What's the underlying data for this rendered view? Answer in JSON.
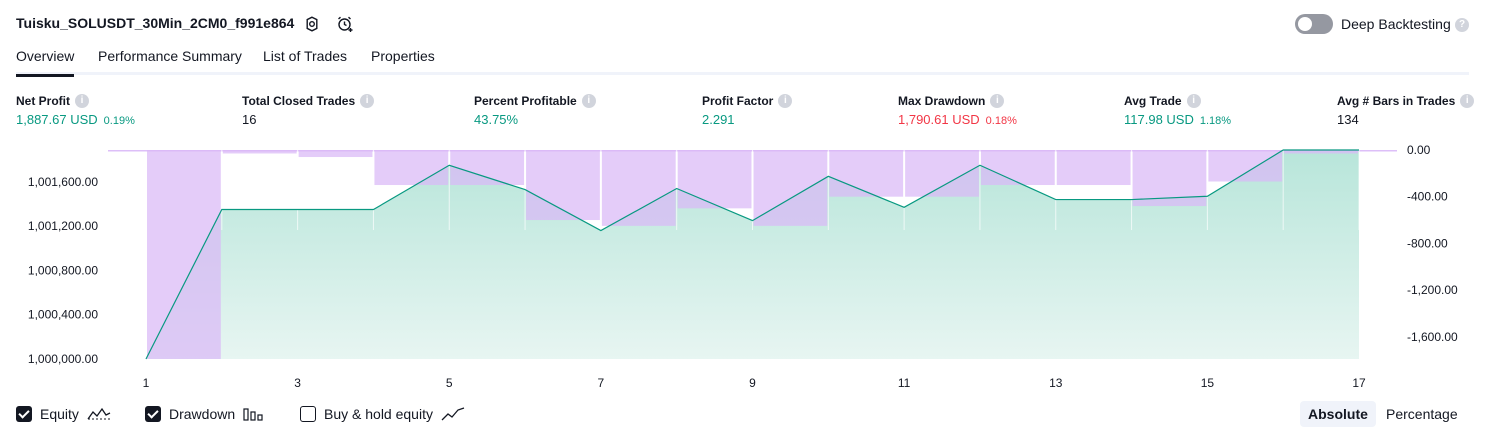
{
  "header": {
    "strategy_title": "Tuisku_SOLUSDT_30Min_2CM0_f991e864",
    "deep_backtesting_label": "Deep Backtesting",
    "deep_backtesting_enabled": false,
    "help_glyph": "?"
  },
  "tabs": [
    {
      "label": "Overview",
      "active": true
    },
    {
      "label": "Performance Summary",
      "active": false
    },
    {
      "label": "List of Trades",
      "active": false
    },
    {
      "label": "Properties",
      "active": false
    }
  ],
  "stats": [
    {
      "label": "Net Profit",
      "value": "1,887.67 USD",
      "percent": "0.19%",
      "tone": "green"
    },
    {
      "label": "Total Closed Trades",
      "value": "16",
      "percent": "",
      "tone": "dark"
    },
    {
      "label": "Percent Profitable",
      "value": "43.75%",
      "percent": "",
      "tone": "green"
    },
    {
      "label": "Profit Factor",
      "value": "2.291",
      "percent": "",
      "tone": "green"
    },
    {
      "label": "Max Drawdown",
      "value": "1,790.61 USD",
      "percent": "0.18%",
      "tone": "red"
    },
    {
      "label": "Avg Trade",
      "value": "117.98 USD",
      "percent": "1.18%",
      "tone": "green"
    },
    {
      "label": "Avg # Bars in Trades",
      "value": "134",
      "percent": "",
      "tone": "dark"
    }
  ],
  "chart_data": {
    "type": "area",
    "x": [
      1,
      2,
      3,
      4,
      5,
      6,
      7,
      8,
      9,
      10,
      11,
      12,
      13,
      14,
      15,
      16,
      17
    ],
    "x_ticks": [
      "1",
      "3",
      "5",
      "7",
      "9",
      "11",
      "13",
      "15",
      "17"
    ],
    "left_axis": {
      "ticks": [
        "1,000,000.00",
        "1,000,400.00",
        "1,000,800.00",
        "1,001,200.00",
        "1,001,600.00"
      ],
      "range": [
        1000000,
        1001887.67
      ]
    },
    "right_axis": {
      "ticks": [
        "0.00",
        "-400.00",
        "-800.00",
        "-1,200.00",
        "-1,600.00"
      ],
      "range": [
        -1790.61,
        0
      ]
    },
    "series": [
      {
        "name": "Equity",
        "color": "#089981",
        "values": [
          1000000,
          1001350,
          1001350,
          1001350,
          1001750,
          1001530,
          1001160,
          1001540,
          1001250,
          1001650,
          1001370,
          1001750,
          1001440,
          1001440,
          1001470,
          1001887.67,
          1001887.67
        ]
      },
      {
        "name": "Drawdown",
        "color": "#c9a8f5",
        "values": [
          0,
          -1790.61,
          -30,
          -60,
          -300,
          -300,
          -600,
          -650,
          -500,
          -650,
          -400,
          -400,
          -300,
          -300,
          -480,
          -270,
          -30
        ]
      }
    ],
    "grid": false
  },
  "legend": [
    {
      "label": "Equity",
      "checked": true,
      "icon": "equity-line-icon"
    },
    {
      "label": "Drawdown",
      "checked": true,
      "icon": "drawdown-bars-icon"
    },
    {
      "label": "Buy & hold equity",
      "checked": false,
      "icon": "buy-hold-line-icon"
    }
  ],
  "view_modes": [
    {
      "label": "Absolute",
      "active": true
    },
    {
      "label": "Percentage",
      "active": false
    }
  ],
  "colors": {
    "profit_green": "#089981",
    "loss_red": "#f23645",
    "equity_fill": "#c9ebe2",
    "drawdown_fill": "#d9b8f7"
  }
}
